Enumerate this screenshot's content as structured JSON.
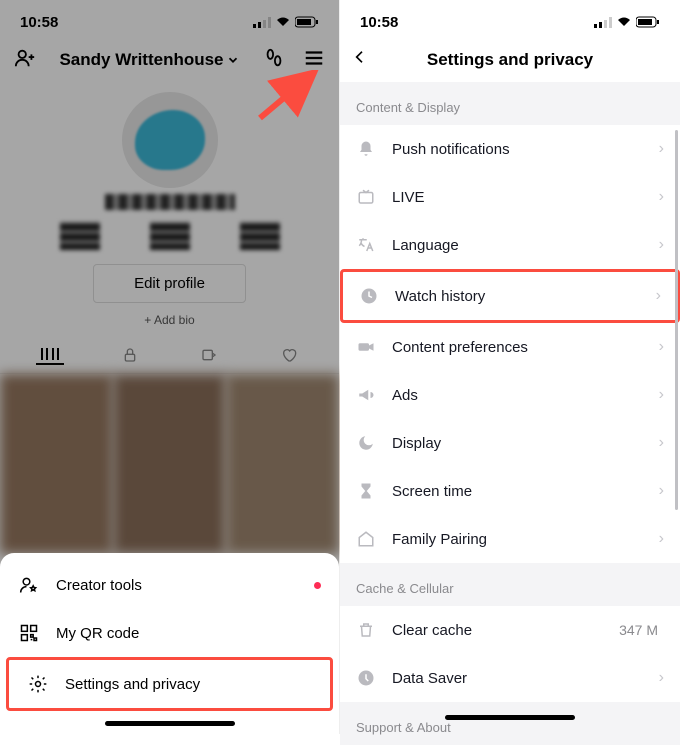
{
  "statusbar": {
    "time": "10:58"
  },
  "profile": {
    "name": "Sandy Writtenhouse",
    "edit_label": "Edit profile",
    "add_bio_label": "+ Add bio"
  },
  "sheet": {
    "creator_tools": "Creator tools",
    "qr_code": "My QR code",
    "settings_privacy": "Settings and privacy"
  },
  "settings": {
    "title": "Settings and privacy",
    "section_content": "Content & Display",
    "section_cache": "Cache & Cellular",
    "section_support": "Support & About",
    "items": {
      "push": "Push notifications",
      "live": "LIVE",
      "language": "Language",
      "watch_history": "Watch history",
      "content_prefs": "Content preferences",
      "ads": "Ads",
      "display": "Display",
      "screen_time": "Screen time",
      "family": "Family Pairing",
      "clear_cache": "Clear cache",
      "clear_cache_value": "347 M",
      "data_saver": "Data Saver"
    }
  }
}
